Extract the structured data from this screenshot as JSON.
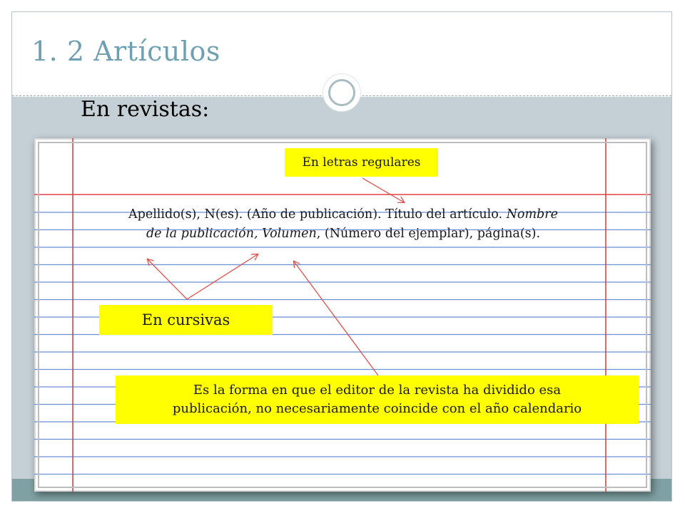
{
  "slide": {
    "title": "1. 2 Artículos",
    "subtitle": "En revistas:"
  },
  "citation": {
    "line1_regular": "Apellido(s), N(es). (Año de publicación). Título del artículo. ",
    "line1_italic": "Nombre",
    "line2_italic_a": "de la publicación,  Volumen",
    "line2_regular": ", (Número del ejemplar), página(s)."
  },
  "labels": {
    "regular_letters": "En letras regulares",
    "italics": "En cursivas",
    "note_line1": "Es la forma en que el editor de la revista ha dividido esa",
    "note_line2": "publicación,  no necesariamente coincide con el año calendario"
  },
  "colors": {
    "title": "#6f9fb3",
    "body_band": "#c4cfd6",
    "footer_band": "#7fa1a3",
    "label_background": "#ffff00",
    "notebook_rule_blue": "#6b8fd6",
    "notebook_margin_red": "#e04040",
    "arrow": "#e0504a"
  }
}
